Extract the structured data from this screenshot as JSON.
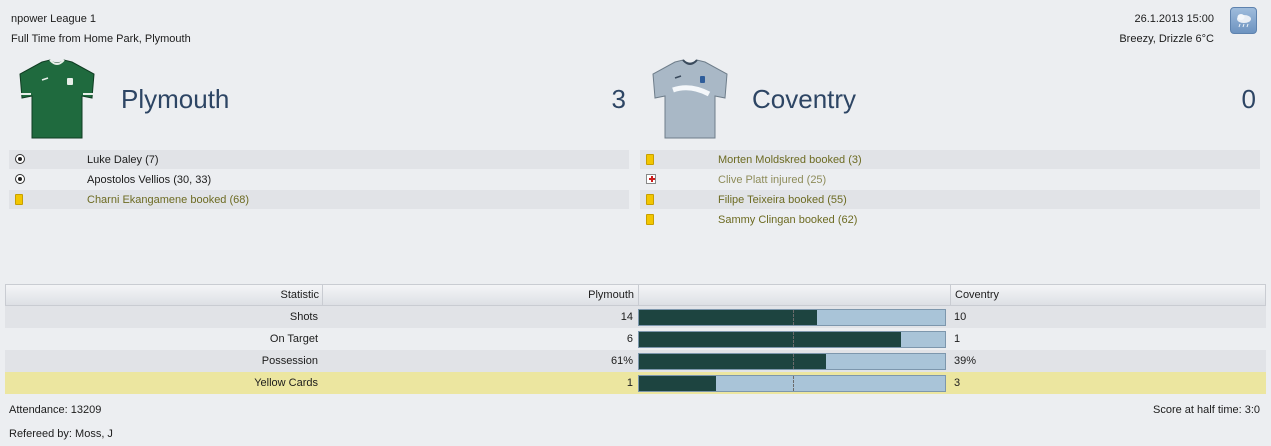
{
  "header": {
    "competition": "npower League 1",
    "venue_line": "Full Time from Home Park, Plymouth",
    "datetime": "26.1.2013 15:00",
    "weather": "Breezy, Drizzle 6°C",
    "weather_icon": "drizzle-cloud-icon"
  },
  "home": {
    "name": "Plymouth",
    "score": "3",
    "shirt_color": "#1f6a3e",
    "events": [
      {
        "icon": "goal-ball-icon",
        "text": "Luke Daley (7)",
        "type": "goal"
      },
      {
        "icon": "goal-ball-icon",
        "text": "Apostolos Vellios (30, 33)",
        "type": "goal"
      },
      {
        "icon": "yellow-card-icon",
        "text": "Charni Ekangamene booked (68)",
        "type": "book"
      }
    ]
  },
  "away": {
    "name": "Coventry",
    "score": "0",
    "shirt_color": "#a9b8c6",
    "events": [
      {
        "icon": "yellow-card-icon",
        "text": "Morten Moldskred booked (3)",
        "type": "book"
      },
      {
        "icon": "injury-cross-icon",
        "text": "Clive Platt injured (25)",
        "type": "injury"
      },
      {
        "icon": "yellow-card-icon",
        "text": "Filipe Teixeira booked (55)",
        "type": "book"
      },
      {
        "icon": "yellow-card-icon",
        "text": "Sammy Clingan booked (62)",
        "type": "book"
      }
    ]
  },
  "stats": {
    "headers": {
      "statistic": "Statistic",
      "home": "Plymouth",
      "away": "Coventry"
    },
    "rows": [
      {
        "label": "Shots",
        "home": "14",
        "away": "10",
        "home_share": 0.583
      },
      {
        "label": "On Target",
        "home": "6",
        "away": "1",
        "home_share": 0.857
      },
      {
        "label": "Possession",
        "home": "61%",
        "away": "39%",
        "home_share": 0.61
      },
      {
        "label": "Yellow Cards",
        "home": "1",
        "away": "3",
        "home_share": 0.25
      }
    ],
    "home_bar_color": "#1d4440",
    "away_bar_color": "#a9c4d8"
  },
  "footer": {
    "attendance": "Attendance: 13209",
    "referee": "Refereed by: Moss, J",
    "half_time": "Score at half time: 3:0"
  }
}
